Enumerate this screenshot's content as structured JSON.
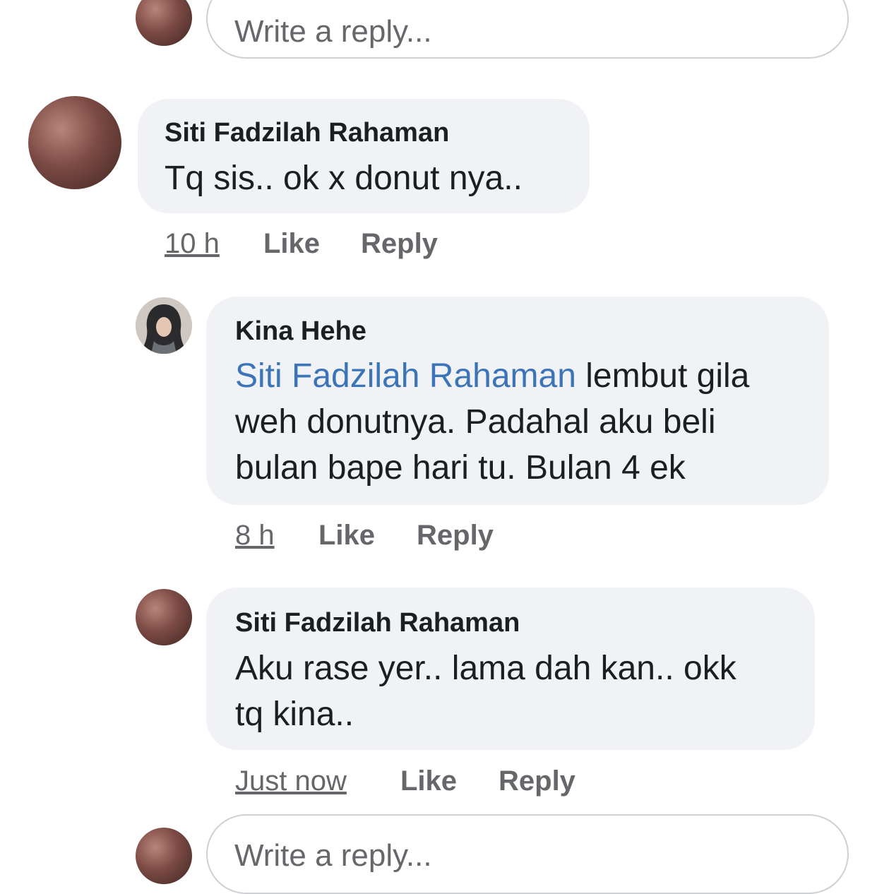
{
  "reply_box_top": {
    "placeholder": "Write a reply..."
  },
  "comment_1": {
    "author": "Siti Fadzilah Rahaman",
    "text": "Tq sis.. ok x donut nya..",
    "time": "10 h",
    "like_label": "Like",
    "reply_label": "Reply"
  },
  "reply_1": {
    "author": "Kina Hehe",
    "mention": "Siti Fadzilah Rahaman",
    "line1_rest": " lembut gila",
    "line2": "weh donutnya. Padahal aku beli",
    "line3": "bulan bape hari tu. Bulan 4 ek",
    "time": "8 h",
    "like_label": "Like",
    "reply_label": "Reply"
  },
  "reply_2": {
    "author": "Siti Fadzilah Rahaman",
    "line1": "Aku rase yer.. lama dah kan.. okk",
    "line2": "tq kina..",
    "time": "Just now",
    "like_label": "Like",
    "reply_label": "Reply"
  },
  "reply_box_bottom": {
    "placeholder": "Write a reply..."
  },
  "colors": {
    "bubble": "#f0f2f5",
    "mention": "#3b75b8",
    "meta": "#65676b"
  }
}
